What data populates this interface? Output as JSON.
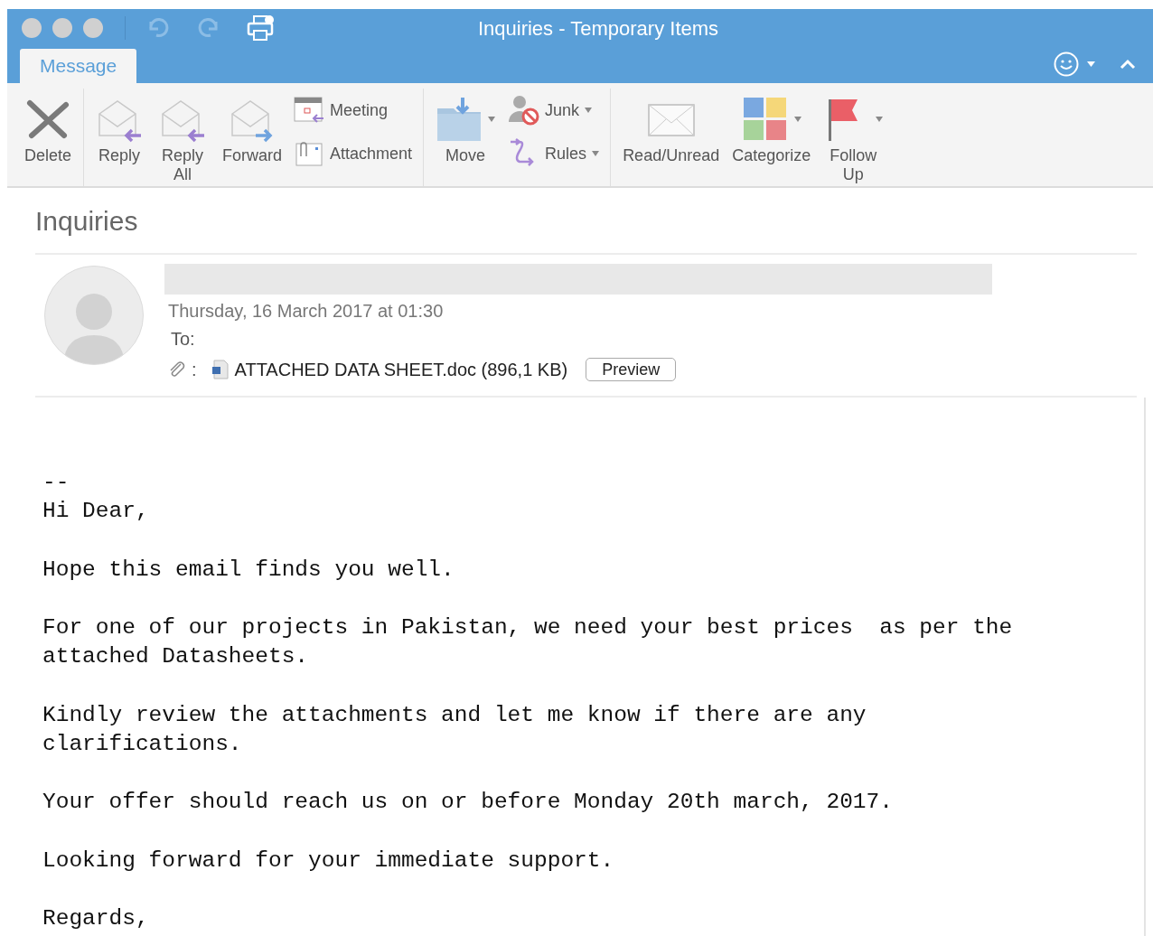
{
  "window": {
    "title": "Inquiries - Temporary Items"
  },
  "tabs": [
    {
      "label": "Message",
      "selected": true
    }
  ],
  "ribbon": {
    "groups": [
      {
        "items": [
          {
            "label": "Delete",
            "kind": "large",
            "dropdown": false
          }
        ]
      },
      {
        "items": [
          {
            "label": "Reply",
            "kind": "large",
            "dropdown": false
          },
          {
            "label": "Reply All",
            "kind": "large",
            "dropdown": false
          },
          {
            "label": "Forward",
            "kind": "large",
            "dropdown": false
          },
          {
            "label": "Meeting",
            "kind": "small",
            "dropdown": false
          },
          {
            "label": "Attachment",
            "kind": "small",
            "dropdown": false
          }
        ]
      },
      {
        "items": [
          {
            "label": "Move",
            "kind": "large",
            "dropdown": true
          },
          {
            "label": "Junk",
            "kind": "small",
            "dropdown": true
          },
          {
            "label": "Rules",
            "kind": "small",
            "dropdown": true
          }
        ]
      },
      {
        "items": [
          {
            "label": "Read/Unread",
            "kind": "large",
            "dropdown": false
          },
          {
            "label": "Categorize",
            "kind": "large",
            "dropdown": true
          },
          {
            "label": "Follow Up",
            "kind": "large",
            "dropdown": true
          }
        ]
      }
    ]
  },
  "message": {
    "subject": "Inquiries",
    "date": "Thursday, 16 March 2017 at 01:30",
    "to_label": "To:",
    "attachment_separator": ":",
    "attachment": "ATTACHED DATA SHEET.doc (896,1 KB)",
    "preview_button": "Preview"
  },
  "body": {
    "paragraphs": [
      [
        "--",
        "Hi Dear,"
      ],
      [
        "Hope this email finds you well."
      ],
      [
        "For one of our projects in Pakistan, we need your best prices  as per the",
        "attached Datasheets."
      ],
      [
        "Kindly review the attachments and let me know if there are any",
        "clarifications."
      ],
      [
        "Your offer should reach us on or before Monday 20th march, 2017."
      ],
      [
        "Looking forward for your immediate support."
      ],
      [
        "Regards,"
      ]
    ]
  }
}
